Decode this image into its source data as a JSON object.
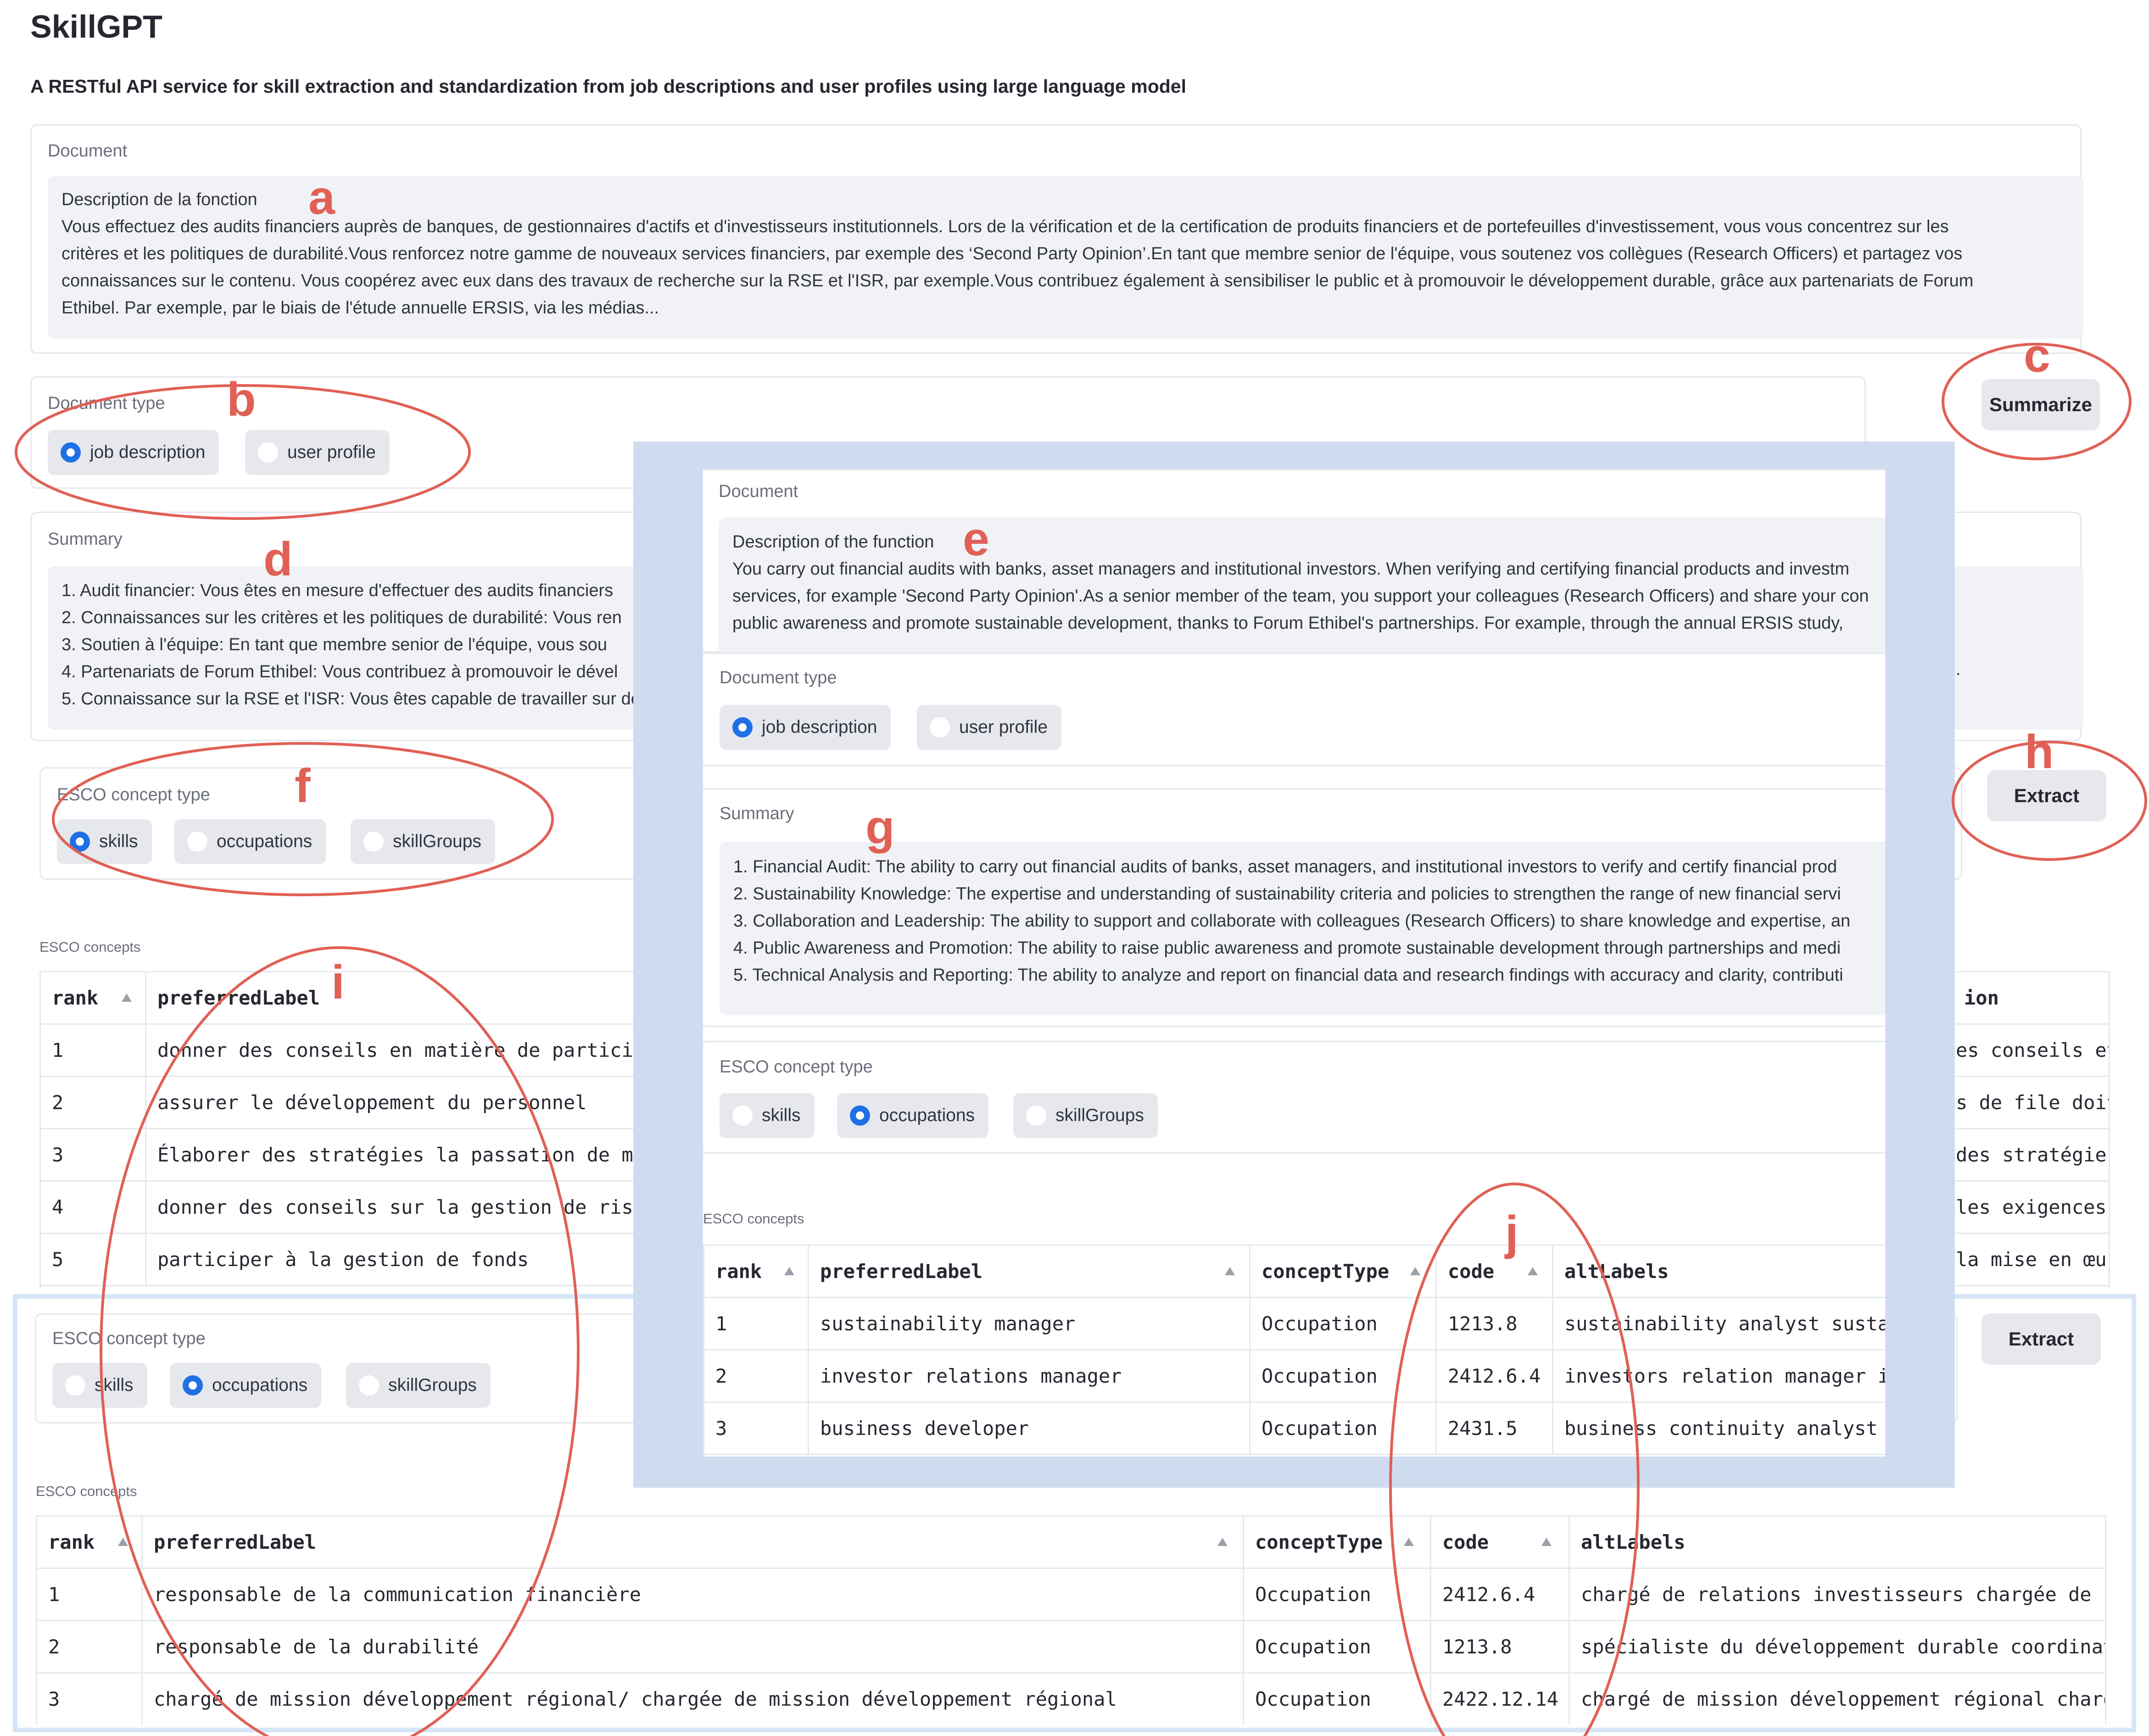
{
  "app": {
    "title": "SkillGPT",
    "subtitle": "A RESTful API service for skill extraction and standardization from job descriptions and user profiles using large language model"
  },
  "main": {
    "document_label": "Document",
    "document_lines": [
      "Description de la fonction",
      "Vous effectuez des audits financiers auprès de banques, de gestionnaires d'actifs et d'investisseurs institutionnels. Lors de la vérification et de la certification de produits financiers et de portefeuilles d'investissement, vous vous concentrez sur les",
      "critères et les politiques de durabilité.Vous renforcez notre gamme de nouveaux services financiers, par exemple des ‘Second Party Opinion’.En tant que membre senior de l'équipe, vous soutenez vos collègues (Research Officers) et partagez vos",
      "connaissances sur le contenu. Vous coopérez avec eux dans des travaux de recherche sur la RSE et l'ISR, par exemple.Vous contribuez également à sensibiliser le public et à promouvoir le développement durable, grâce aux partenariats de Forum",
      "Ethibel. Par exemple, par le biais de l'étude annuelle ERSIS, via les médias..."
    ],
    "doctype_label": "Document type",
    "doctype_options": [
      "job description",
      "user profile"
    ],
    "summarize_label": "Summarize",
    "summary_label": "Summary",
    "summary_lines": [
      "1. Audit financier: Vous êtes en mesure d'effectuer des audits financiers",
      "2. Connaissances sur les critères et les politiques de durabilité: Vous ren",
      "3. Soutien à l'équipe: En tant que membre senior de l'équipe, vous sou",
      "4. Partenariats de Forum Ethibel: Vous contribuez à promouvoir le dével",
      "5. Connaissance sur la RSE et l'ISR: Vous êtes capable de travailler sur de"
    ],
    "summary_tail": ".",
    "concept_type_label": "ESCO concept type",
    "concept_options": [
      "skills",
      "occupations",
      "skillGroups"
    ],
    "extract_label": "Extract",
    "concepts_label": "ESCO concepts",
    "table_headers": [
      "rank",
      "preferredLabel"
    ],
    "table_right_header": "ion",
    "table_rows": [
      {
        "rank": "1",
        "label": "donner des conseils en matière de particip",
        "right": "es conseils et"
      },
      {
        "rank": "2",
        "label": "assurer le développement du personnel",
        "right": "s de file doiv"
      },
      {
        "rank": "3",
        "label": "Élaborer des stratégies la passation de ma",
        "right": " des stratégie"
      },
      {
        "rank": "4",
        "label": "donner des conseils sur la gestion de risq",
        "right": "les exigences"
      },
      {
        "rank": "5",
        "label": "participer à la gestion de fonds",
        "right": " la mise en œu"
      }
    ]
  },
  "english": {
    "document_label": "Document",
    "document_lines": [
      "Description of the function",
      "You carry out financial audits with banks, asset managers and institutional investors. When verifying and certifying financial products and investm",
      "services, for example 'Second Party Opinion'.As a senior member of the team, you support your colleagues (Research Officers) and share your con",
      "public awareness and promote sustainable development, thanks to Forum Ethibel's partnerships. For example, through the annual ERSIS study,"
    ],
    "doctype_label": "Document type",
    "doctype_options": [
      "job description",
      "user profile"
    ],
    "summary_label": "Summary",
    "summary_lines": [
      "1. Financial Audit: The ability to carry out financial audits of banks, asset managers, and institutional investors to verify and certify financial prod",
      "2. Sustainability Knowledge: The expertise and understanding of sustainability criteria and policies to strengthen the range of new financial servi",
      "3. Collaboration and Leadership: The ability to support and collaborate with colleagues (Research Officers) to share knowledge and expertise, an",
      "4. Public Awareness and Promotion: The ability to raise public awareness and promote sustainable development through partnerships and medi",
      "5. Technical Analysis and Reporting: The ability to analyze and report on financial data and research findings with accuracy and clarity, contributi"
    ],
    "concept_type_label": "ESCO concept type",
    "concept_options": [
      "skills",
      "occupations",
      "skillGroups"
    ],
    "concepts_label": "ESCO concepts",
    "table_headers": [
      "rank",
      "preferredLabel",
      "conceptType",
      "code",
      "altLabels"
    ],
    "table_rows": [
      {
        "rank": "1",
        "label": "sustainability manager",
        "type": "Occupation",
        "code": "1213.8",
        "alt": "sustainability analyst susta"
      },
      {
        "rank": "2",
        "label": "investor relations manager",
        "type": "Occupation",
        "code": "2412.6.4",
        "alt": "investors relation manager i"
      },
      {
        "rank": "3",
        "label": "business developer",
        "type": "Occupation",
        "code": "2431.5",
        "alt": "business continuity analyst"
      }
    ]
  },
  "bottom": {
    "concept_type_label": "ESCO concept type",
    "concept_options": [
      "skills",
      "occupations",
      "skillGroups"
    ],
    "extract_label": "Extract",
    "concepts_label": "ESCO concepts",
    "table_headers": [
      "rank",
      "preferredLabel",
      "conceptType",
      "code",
      "altLabels"
    ],
    "table_rows": [
      {
        "rank": "1",
        "label": "responsable de la communication financière",
        "type": "Occupation",
        "code": "2412.6.4",
        "alt": "chargé de relations investisseurs chargée de r"
      },
      {
        "rank": "2",
        "label": "responsable de la durabilité",
        "type": "Occupation",
        "code": "1213.8",
        "alt": "spécialiste du développement durable coordinat"
      },
      {
        "rank": "3",
        "label": "chargé de mission développement régional/ chargée de mission développement régional",
        "type": "Occupation",
        "code": "2422.12.14",
        "alt": "chargé de mission développement régional charg"
      }
    ]
  },
  "annotations": [
    "a",
    "b",
    "c",
    "d",
    "e",
    "f",
    "g",
    "h",
    "i",
    "j"
  ],
  "colors": {
    "annotation": "#e06055",
    "radio_on": "#1f6fe5",
    "overlay_frame": "#cfdcf0",
    "bottom_frame": "#d6e6f7"
  }
}
